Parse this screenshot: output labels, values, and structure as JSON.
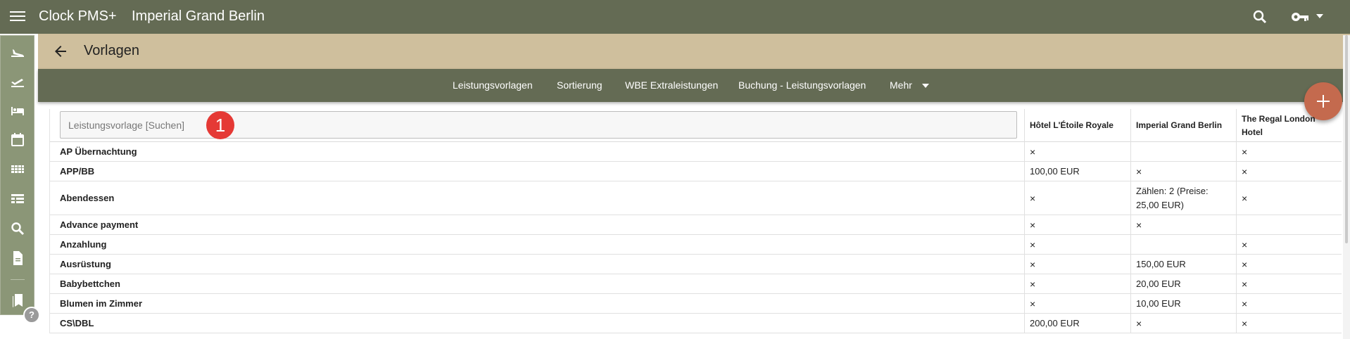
{
  "app": {
    "name": "Clock PMS+",
    "property": "Imperial Grand Berlin"
  },
  "header": {
    "title": "Vorlagen"
  },
  "tabs": [
    "Leistungsvorlagen",
    "Sortierung",
    "WBE Extraleistungen",
    "Buchung - Leistungsvorlagen",
    "Mehr"
  ],
  "sidebar": {
    "items": [
      "arrivals-icon",
      "departures-icon",
      "rooms-icon",
      "calendar-icon",
      "grid-icon",
      "table-view-icon",
      "search-icon",
      "document-icon",
      "bookmarks-icon"
    ]
  },
  "help_label": "?",
  "search": {
    "placeholder": "Leistungsvorlage [Suchen]"
  },
  "annotation_badge": "1",
  "table": {
    "columns": [
      "Hôtel L'Étoile Royale",
      "Imperial Grand Berlin",
      "The Regal London Hotel"
    ],
    "rows": [
      {
        "name": "AP Übernachtung",
        "cells": [
          "×",
          "",
          "×"
        ]
      },
      {
        "name": "APP/BB",
        "cells": [
          "100,00 EUR",
          "×",
          "×"
        ]
      },
      {
        "name": "Abendessen",
        "cells": [
          "×",
          "Zählen: 2 (Preise: 25,00 EUR)",
          "×"
        ]
      },
      {
        "name": "Advance payment",
        "cells": [
          "×",
          "×",
          ""
        ]
      },
      {
        "name": "Anzahlung",
        "cells": [
          "×",
          "",
          "×"
        ]
      },
      {
        "name": "Ausrüstung",
        "cells": [
          "×",
          "150,00 EUR",
          "×"
        ]
      },
      {
        "name": "Babybettchen",
        "cells": [
          "×",
          "20,00 EUR",
          "×"
        ]
      },
      {
        "name": "Blumen im Zimmer",
        "cells": [
          "×",
          "10,00 EUR",
          "×"
        ]
      },
      {
        "name": "CS\\DBL",
        "cells": [
          "200,00 EUR",
          "×",
          "×"
        ]
      }
    ]
  },
  "colors": {
    "topbar": "#646b54",
    "header": "#cfbf9d",
    "sidebar": "#8b9677",
    "fab": "#c46a4e",
    "badge": "#e53935"
  }
}
